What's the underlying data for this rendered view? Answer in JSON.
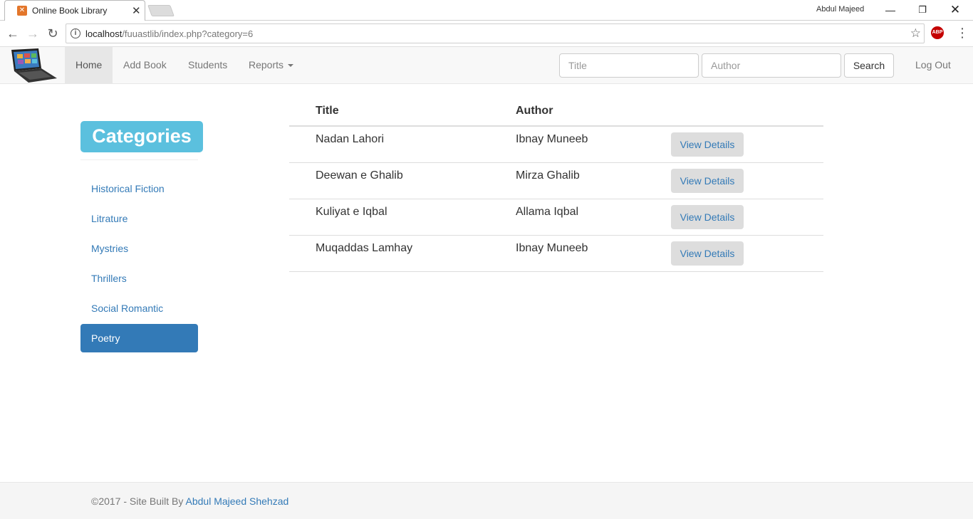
{
  "browser": {
    "tab_title": "Online Book Library",
    "user_name": "Abdul Majeed",
    "url_host": "localhost",
    "url_path": "/fuuastlib/index.php?category=6"
  },
  "navbar": {
    "home": "Home",
    "add_book": "Add Book",
    "students": "Students",
    "reports": "Reports",
    "title_placeholder": "Title",
    "author_placeholder": "Author",
    "search_label": "Search",
    "logout": "Log Out"
  },
  "sidebar": {
    "heading": "Categories",
    "items": [
      {
        "label": "Historical Fiction"
      },
      {
        "label": "Litrature"
      },
      {
        "label": "Mystries"
      },
      {
        "label": "Thrillers"
      },
      {
        "label": "Social Romantic"
      },
      {
        "label": "Poetry"
      }
    ],
    "active": "Poetry"
  },
  "table": {
    "headers": [
      "Title",
      "Author"
    ],
    "button_label": "View Details",
    "rows": [
      {
        "title": "Nadan Lahori",
        "author": "Ibnay Muneeb"
      },
      {
        "title": "Deewan e Ghalib",
        "author": "Mirza Ghalib"
      },
      {
        "title": "Kuliyat e Iqbal",
        "author": "Allama Iqbal"
      },
      {
        "title": "Muqaddas Lamhay",
        "author": "Ibnay Muneeb"
      }
    ]
  },
  "footer": {
    "prefix": "©2017 - Site Built By ",
    "author": "Abdul Majeed Shehzad"
  },
  "colors": {
    "primary": "#337ab7",
    "info": "#5bc0de",
    "navbar_bg": "#f8f8f8"
  }
}
